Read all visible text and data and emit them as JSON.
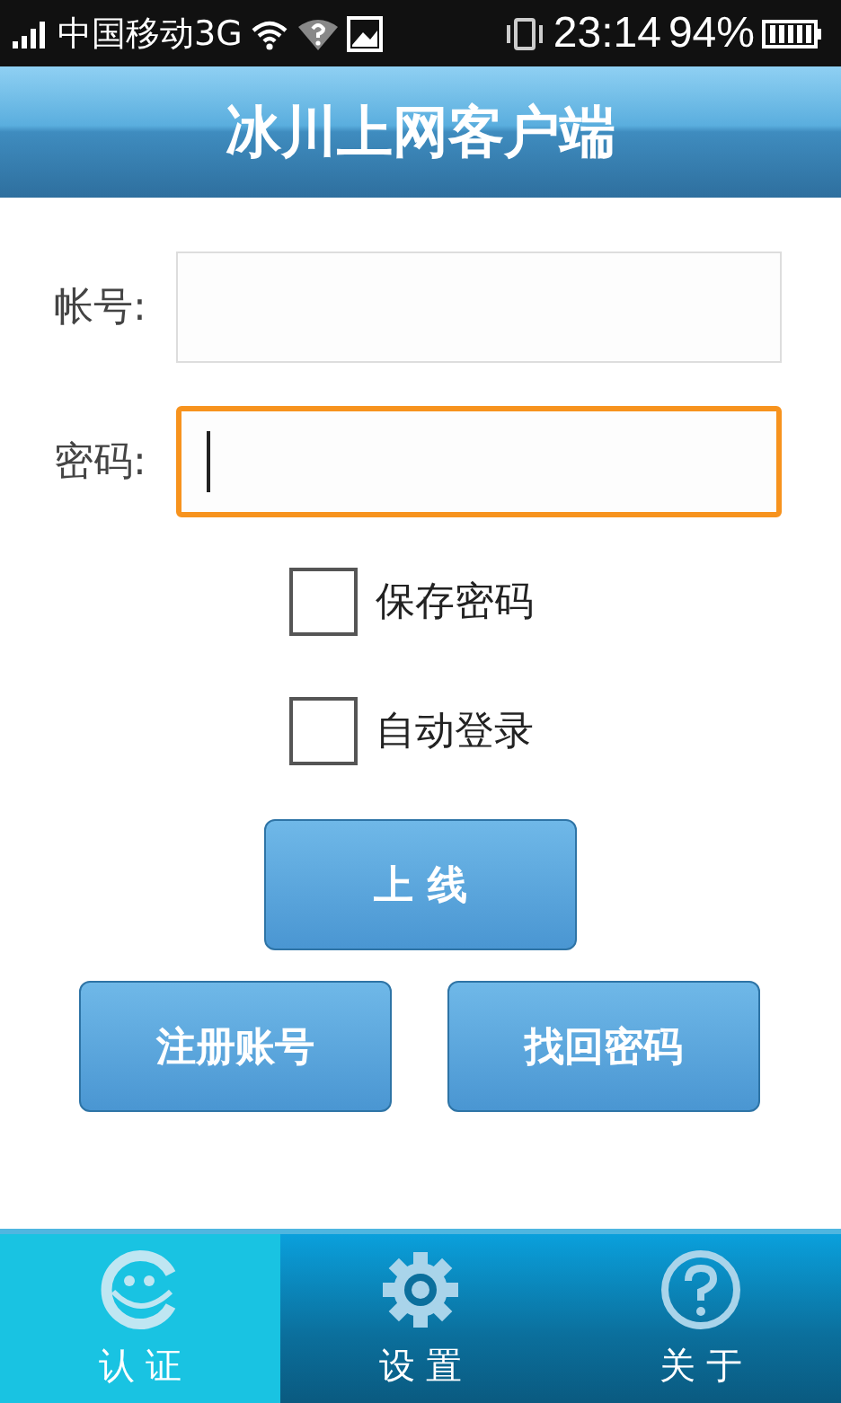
{
  "status_bar": {
    "carrier": "中国移动3G",
    "time": "23:14",
    "battery": "94%"
  },
  "title_bar": {
    "title": "冰川上网客户端"
  },
  "fields": [
    {
      "label": "帐号:",
      "focused": false
    },
    {
      "label": "密码:",
      "focused": true
    }
  ],
  "checkboxes": [
    {
      "label": "保存密码",
      "checked": false
    },
    {
      "label": "自动登录",
      "checked": false
    }
  ],
  "primary_button": "上 线",
  "secondary_buttons": [
    "注册账号",
    "找回密码"
  ],
  "tabs": [
    {
      "label": "认 证",
      "selected": true,
      "kind": "smile"
    },
    {
      "label": "设 置",
      "selected": false,
      "kind": "gear"
    },
    {
      "label": "关 于",
      "selected": false,
      "kind": "help"
    }
  ]
}
